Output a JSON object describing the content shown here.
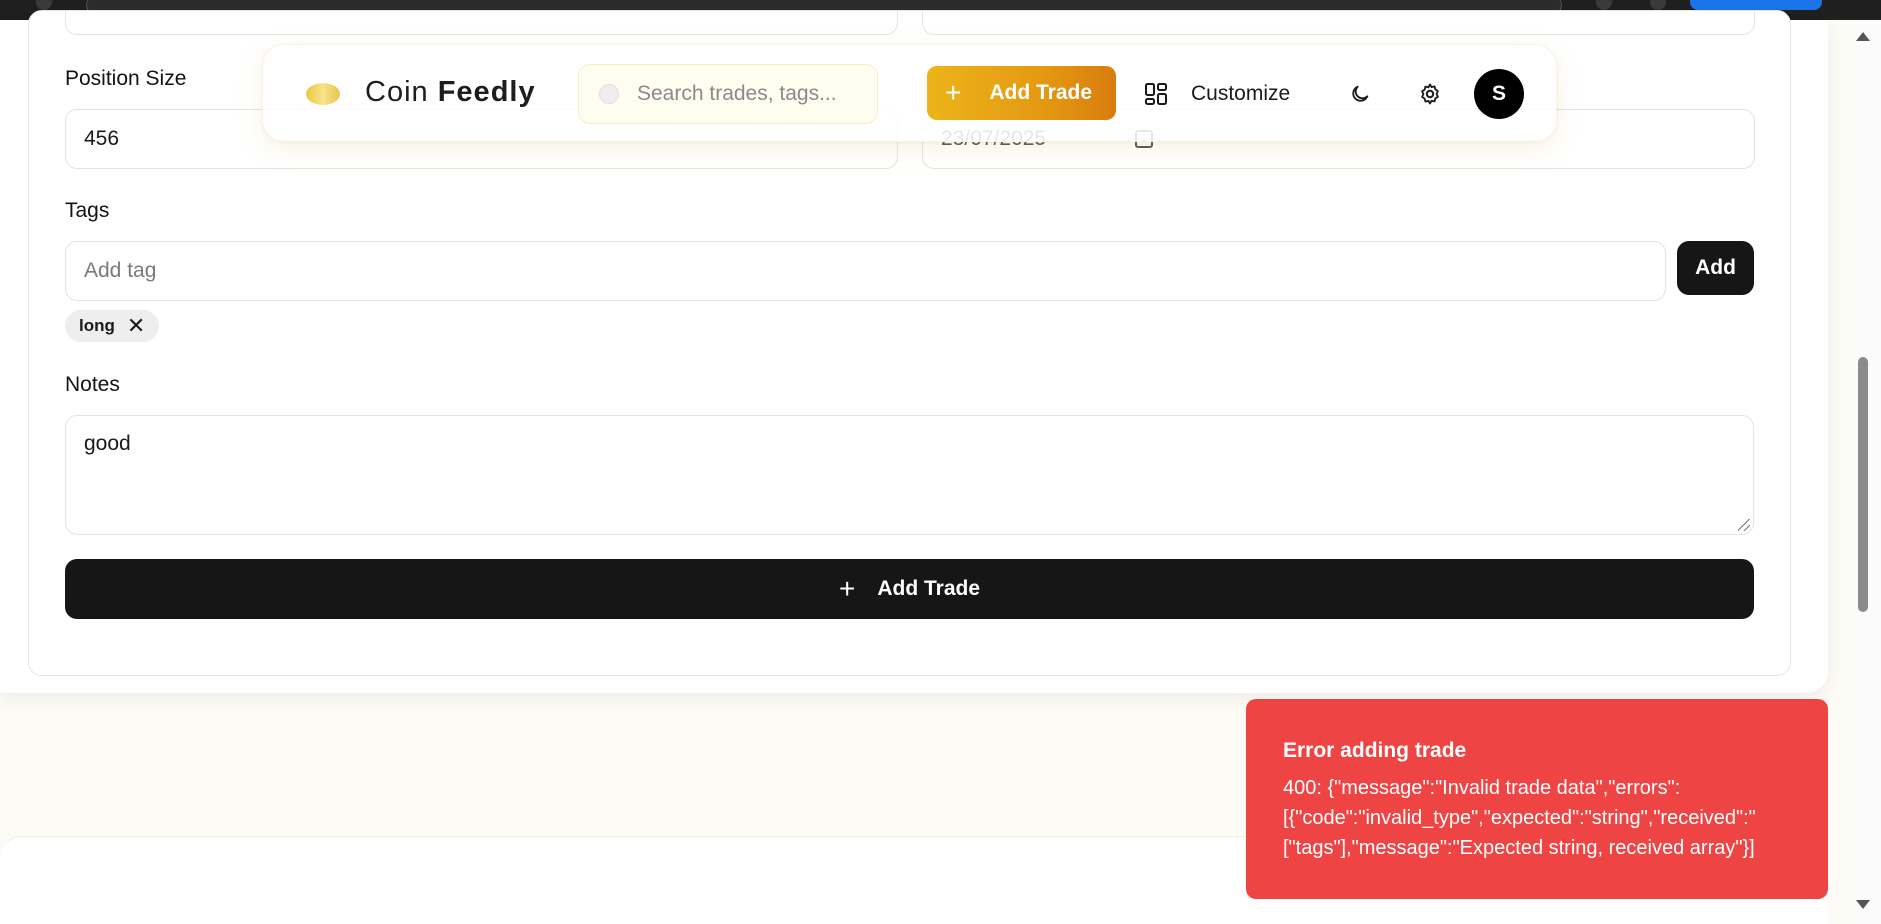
{
  "app": {
    "name_part1": "Coin",
    "name_part2": "Feedly"
  },
  "nav": {
    "search_placeholder": "Search trades, tags...",
    "add_trade_label": "Add Trade",
    "customize_label": "Customize",
    "avatar_initial": "S"
  },
  "form": {
    "position_size": {
      "label": "Position Size",
      "value": "456"
    },
    "date_value_partial": "23/07/2025",
    "tags": {
      "label": "Tags",
      "placeholder": "Add tag",
      "add_label": "Add",
      "items": [
        "long"
      ]
    },
    "notes": {
      "label": "Notes",
      "value": "good"
    },
    "submit_label": "Add Trade"
  },
  "toast": {
    "title": "Error adding trade",
    "line1": "400: {\"message\":\"Invalid trade data\",\"errors\":",
    "line2": "[{\"code\":\"invalid_type\",\"expected\":\"string\",\"received\":\"",
    "line3": "[\"tags\"],\"message\":\"Expected string, received array\"}]"
  },
  "colors": {
    "accent_gold": "#e49a12",
    "error_red": "#ef4444",
    "dark_button": "#161616"
  }
}
